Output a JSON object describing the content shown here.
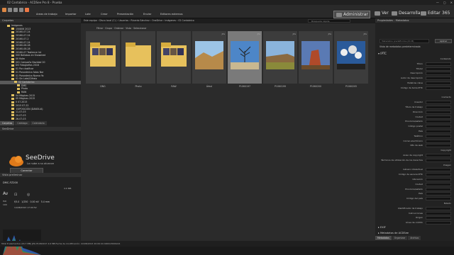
{
  "window": {
    "title": "02 Cantabrico - ACDSee Pro 8 - Prueba"
  },
  "menubar": {
    "items": [
      "Areas de trabajo",
      "Importar",
      "Lote",
      "Crear",
      "Presentación",
      "Enviar",
      "Editores externos"
    ],
    "modes": [
      "Administrar",
      "Ver",
      "Desarrollar",
      "Editar",
      "365"
    ]
  },
  "left": {
    "folders_header": "Carpetas",
    "folders": [
      "Imágenes",
      "150806 2013",
      "20160-07-24",
      "20160-07-24",
      "20160-07-2",
      "20160-07-24",
      "20160-08-28",
      "20160-08-28",
      "20160-07 Tasilence Int",
      "000 Ballabos en Snowmed",
      "0V fixIm",
      "001 Campaña  Navidad 20",
      "DO Fotografias 2016",
      "01 Por clasificar",
      "01 Panorámica fotos Nor",
      "01 Panorámica Nueva Yo",
      "01 Sin Lote/Clifraio",
      "02 Cantabrico",
      "DMS",
      "Photo",
      "RAW",
      "04 Mágicas 2015",
      "05 Mágicas 2015",
      "0 07-2015",
      "2015 07-22",
      "  EXPOSICIÓN (DANOLIA)",
      "11-07-03",
      "20-07-03",
      "26-07-03"
    ],
    "tabs": [
      "Carpetas",
      "Catálogo",
      "Calendario"
    ],
    "seedrive": {
      "header": "SeeDrive",
      "name": "SeeDrive",
      "subtitle": "La nube a su alcance",
      "button": "Conectar"
    },
    "preview": {
      "header": "Vista preliminar",
      "camera": "DMC-FZ200",
      "size": "4.0 MB",
      "iso_label": "ISO",
      "iso": "100",
      "mode": "Av",
      "aperture": "f/5.0",
      "shutter": "1/250",
      "ev": "0.00 eV",
      "focal": "5.4 mm",
      "date": "14/08/2013 17:00:52"
    }
  },
  "center": {
    "breadcrumb": "Este equipo  ›  Disco local (C:)  ›  Usuarios  ›  Ricardo Sánchez  ›  OneDrive  ›  Imágenes  ›  02 Cantabrico",
    "search_placeholder": "Búsqueda rápida",
    "filters": [
      "Filtrar",
      "Grupo",
      "Ordenar",
      "Vista",
      "Seleccionar"
    ],
    "thumbnails": [
      {
        "label": "DNG",
        "badge": "",
        "kind": "folder"
      },
      {
        "label": "Photo",
        "badge": "",
        "kind": "folder-empty"
      },
      {
        "label": "RAW",
        "badge": "",
        "kind": "folder"
      },
      {
        "label": "Árbol",
        "badge": "JPG",
        "kind": "hills"
      },
      {
        "label": "P1060197",
        "badge": "JPG",
        "kind": "tree"
      },
      {
        "label": "P1060199",
        "badge": "JPG",
        "kind": "mesa"
      },
      {
        "label": "P1060200",
        "badge": "JPG",
        "kind": "redrock"
      },
      {
        "label": "P1060205",
        "badge": "JPG",
        "kind": "clouds"
      }
    ]
  },
  "right": {
    "header": "Propiedades - Metadatos",
    "preset_placeholder": "Metadatos predefinidos (ID-M)",
    "apply_button": "Aplicar",
    "view_label": "Vista de metadatos predeterminada",
    "section_iptc": "IPTC",
    "fields": [
      "Contenido",
      "Título",
      "Titular",
      "Descripción",
      "Autor de descripción",
      "Palabras clave",
      "Código de tema IPTC",
      "",
      "Contacto",
      "Creador",
      "Título de trabajo",
      "Dirección",
      "Ciudad",
      "Provincia/estado",
      "Código postal",
      "País",
      "Teléfono",
      "Correo electrónico",
      "URL de web",
      "Copyright",
      "Aviso de copyright",
      "Términos de utilización de los derechos",
      "Imagen",
      "Género intelectual",
      "Código de escena IPTC",
      "Ubicación",
      "Ciudad",
      "Provincia/estado",
      "País",
      "Código del país",
      "Estado",
      "Identificador de trabajo",
      "Instrucciones",
      "Origen",
      "Línea de crédito"
    ],
    "section_exif": "EXIF",
    "section_acd": "Metadatos de ACDSee",
    "tabs": [
      "Metadatos",
      "Organizar",
      "Archivo"
    ]
  },
  "status": {
    "text": "Total 8 elementos  (16.7 MB)   JPG  P1060197  4.6 MB  Fecha de modificación: 22/08/2013 20:09:44  4000x3000x24"
  }
}
